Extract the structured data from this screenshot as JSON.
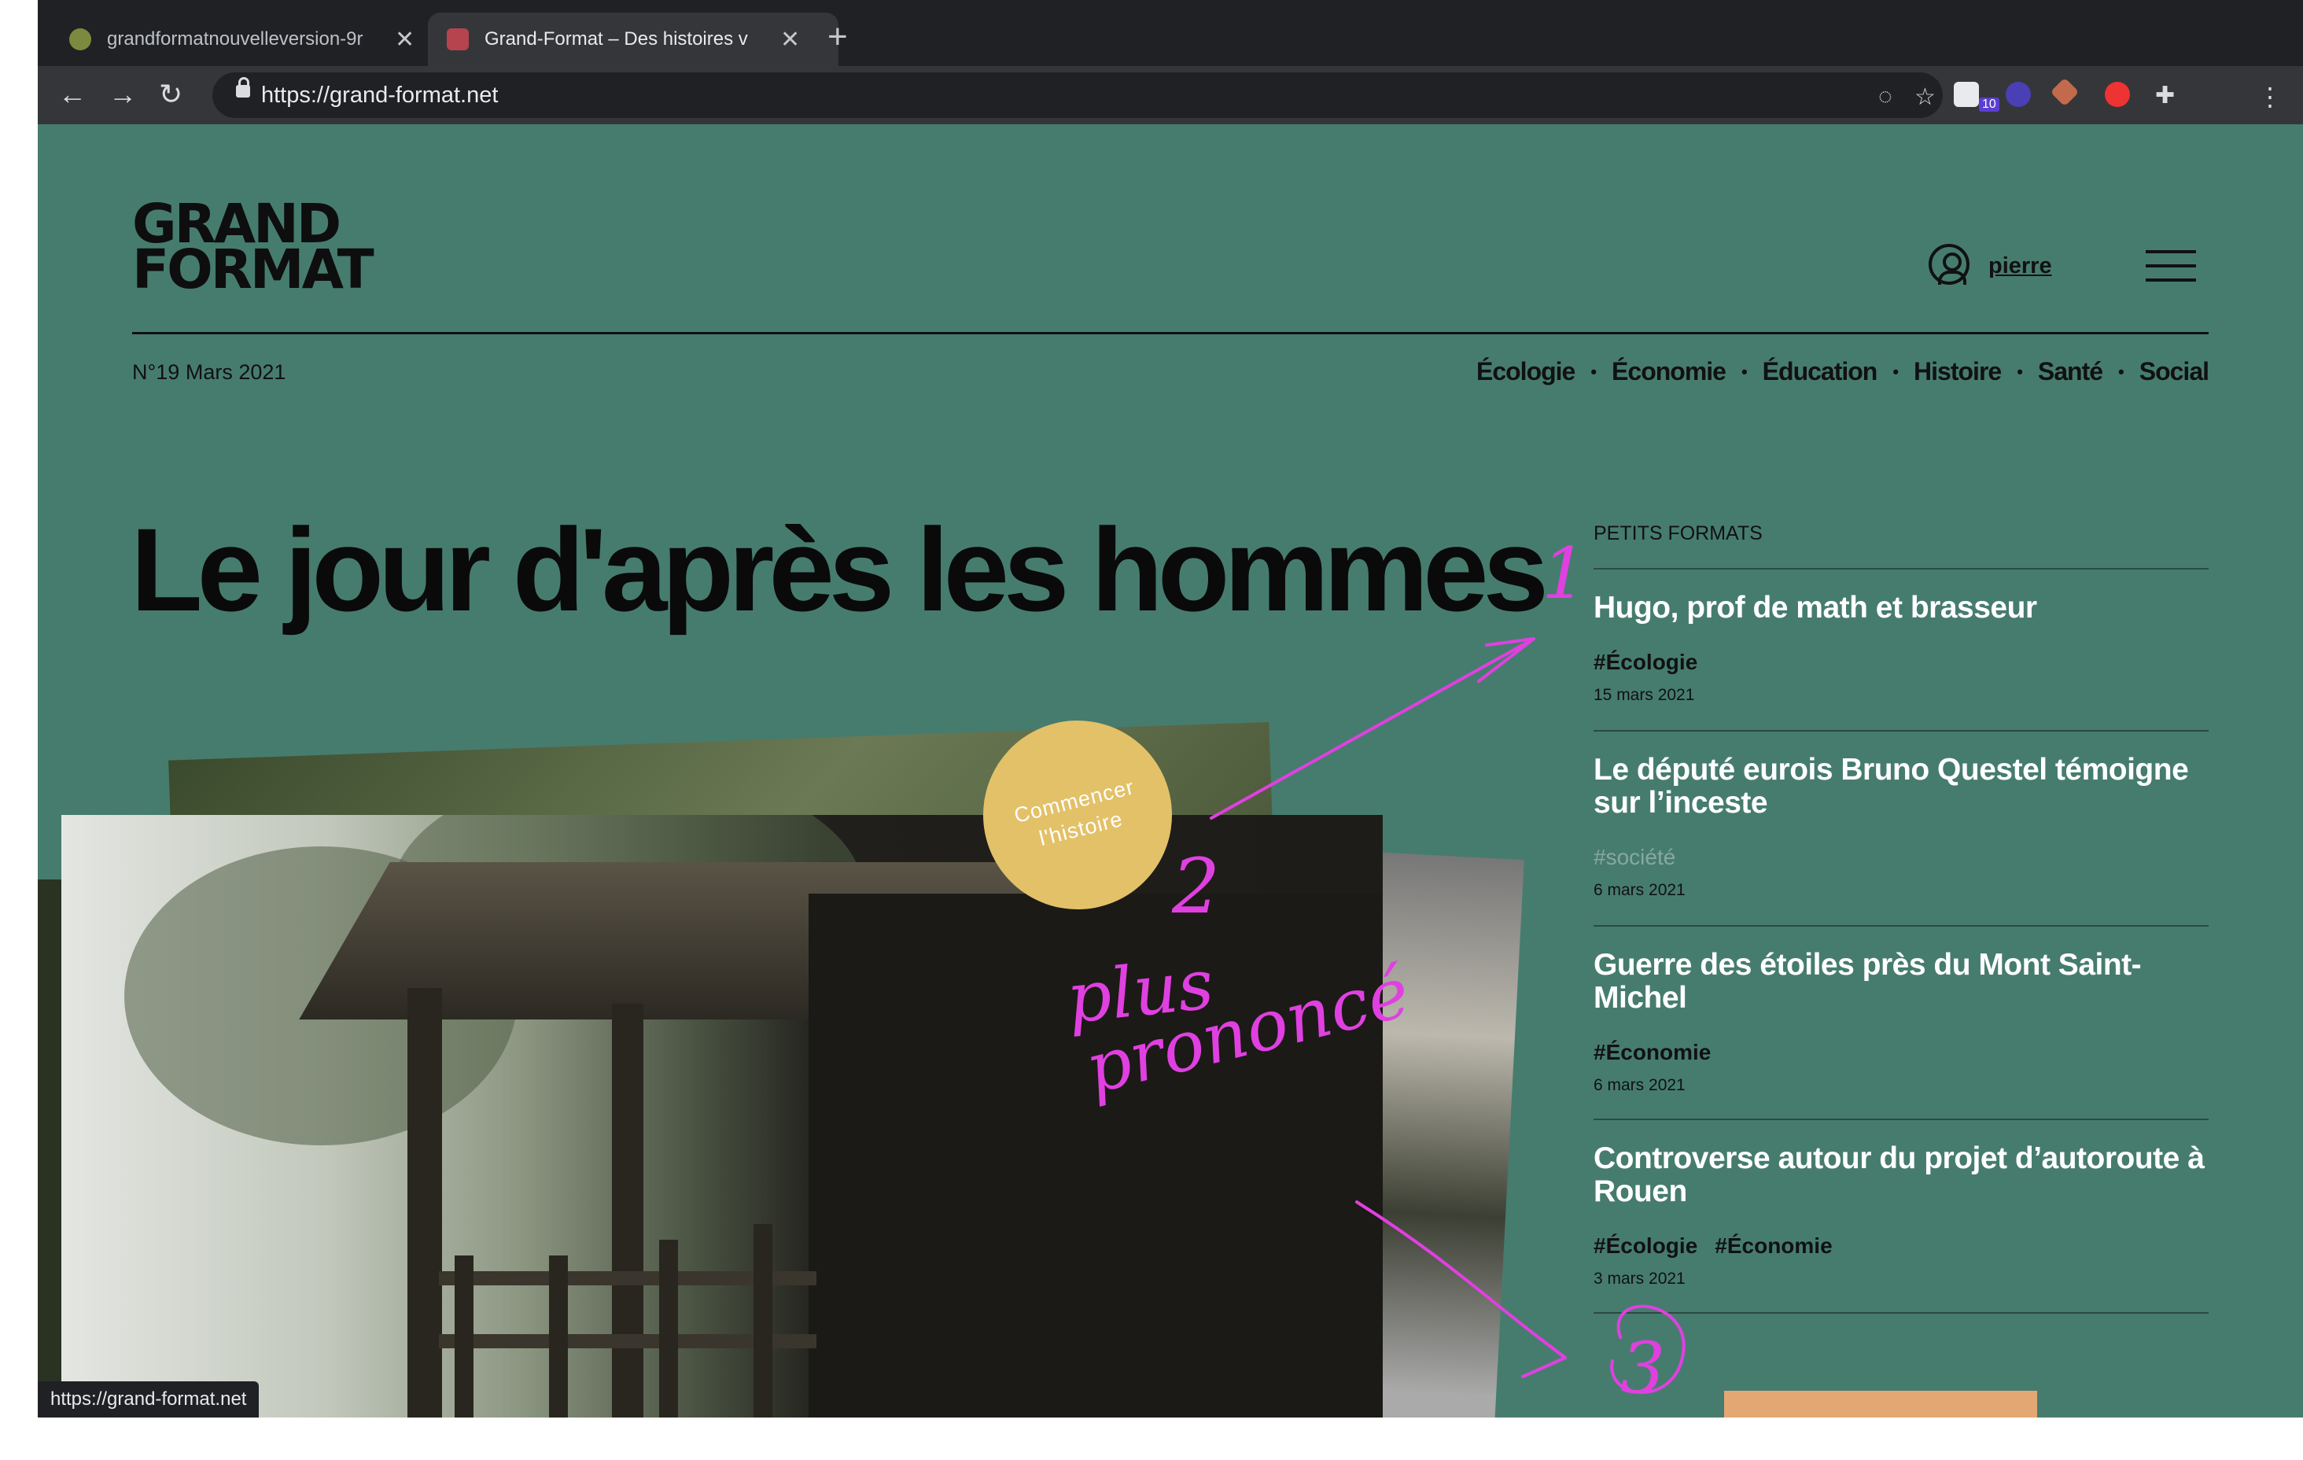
{
  "browser": {
    "tabs": [
      {
        "title": "grandformatnouvelleversion-9r"
      },
      {
        "title": "Grand-Format – Des histoires v"
      }
    ],
    "url": "https://grand-format.net",
    "extension_badge": "10",
    "status_url": "https://grand-format.net"
  },
  "header": {
    "logo_line1": "GRAND",
    "logo_line2": "FORMAT",
    "username": "pierre",
    "issue": "N°19 Mars 2021",
    "nav": [
      "Écologie",
      "Économie",
      "Éducation",
      "Histoire",
      "Santé",
      "Social"
    ]
  },
  "hero": {
    "headline": "Le jour d'après les hommes",
    "cta_line1": "Commencer",
    "cta_line2": "l'histoire"
  },
  "sidebar": {
    "heading": "PETITS FORMATS",
    "items": [
      {
        "title": "Hugo, prof de math et brasseur",
        "tags": [
          "#Écologie"
        ],
        "date": "15 mars 2021"
      },
      {
        "title": "Le député eurois Bruno Questel témoigne sur l’inceste",
        "tags": [
          "#société"
        ],
        "date": "6 mars 2021"
      },
      {
        "title": "Guerre des étoiles près du Mont Saint-Michel",
        "tags": [
          "#Économie"
        ],
        "date": "6 mars 2021"
      },
      {
        "title": "Controverse autour du projet d’autoroute à Rouen",
        "tags": [
          "#Écologie",
          "#Économie"
        ],
        "date": "3 mars 2021"
      }
    ]
  },
  "annotations": {
    "number1": "1",
    "number2": "2",
    "number3": "3",
    "note_line1": "plus",
    "note_line2": "prononcé",
    "color": "#e040e0"
  },
  "colors": {
    "page_bg": "#467c6e",
    "cta": "#e3c168",
    "chrome": "#202124"
  }
}
